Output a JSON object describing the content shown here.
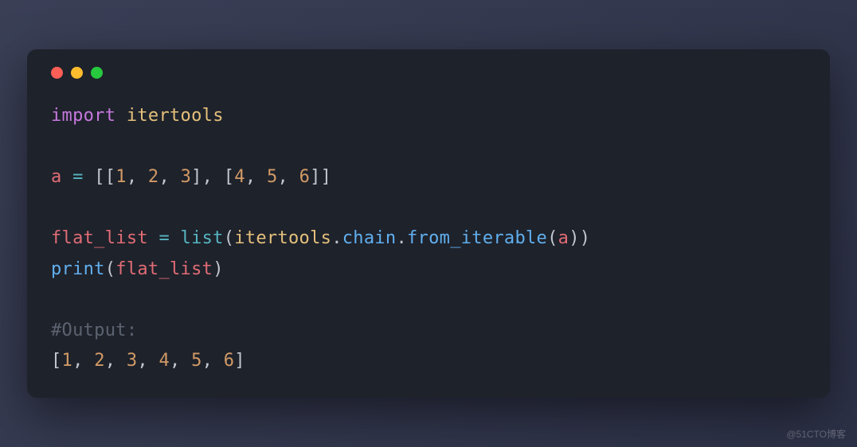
{
  "window": {
    "traffic": {
      "red": "#ff5f56",
      "yellow": "#ffbd2e",
      "green": "#27c93f"
    }
  },
  "code": {
    "line1": {
      "import": "import",
      "module": "itertools"
    },
    "line3": {
      "var_a": "a",
      "eq": "=",
      "open2": "[[",
      "n1": "1",
      "c1": ",",
      "sp": " ",
      "n2": "2",
      "c2": ",",
      "n3": "3",
      "mid": "], [",
      "n4": "4",
      "c3": ",",
      "n5": "5",
      "c4": ",",
      "n6": "6",
      "close2": "]]"
    },
    "line5": {
      "flat": "flat_list",
      "eq": "=",
      "list": "list",
      "open": "(",
      "itertools": "itertools",
      "dot1": ".",
      "chain": "chain",
      "dot2": ".",
      "from_iterable": "from_iterable",
      "open2": "(",
      "a": "a",
      "close": "))"
    },
    "line6": {
      "print": "print",
      "open": "(",
      "flat": "flat_list",
      "close": ")"
    },
    "line8": {
      "comment": "#Output:"
    },
    "line9": {
      "open": "[",
      "n1": "1",
      "c1": ",",
      "sp": " ",
      "n2": "2",
      "c2": ",",
      "n3": "3",
      "c3": ",",
      "n4": "4",
      "c4": ",",
      "n5": "5",
      "c5": ",",
      "n6": "6",
      "close": "]"
    }
  },
  "watermark": "@51CTO博客"
}
